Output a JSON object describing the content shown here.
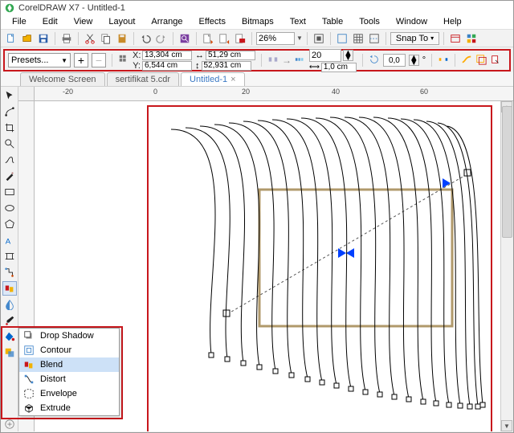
{
  "app": {
    "title": "CorelDRAW X7 - Untitled-1"
  },
  "menus": [
    "File",
    "Edit",
    "View",
    "Layout",
    "Arrange",
    "Effects",
    "Bitmaps",
    "Text",
    "Table",
    "Tools",
    "Window",
    "Help"
  ],
  "toolbar": {
    "zoom": "26%",
    "snap_label": "Snap To"
  },
  "prop": {
    "presets_label": "Presets...",
    "x_label": "X:",
    "y_label": "Y:",
    "x_val": "13,304 cm",
    "y_val": "6,544 cm",
    "w_val": "51,29 cm",
    "h_val": "52,931 cm",
    "steps": "20",
    "step_dist": "1,0 cm",
    "angle": "0,0",
    "deg": "°"
  },
  "tabs": [
    {
      "label": "Welcome Screen",
      "active": false
    },
    {
      "label": "sertifikat 5.cdr",
      "active": false
    },
    {
      "label": "Untitled-1",
      "active": true
    }
  ],
  "ruler": {
    "marks": [
      "-20",
      "0",
      "20",
      "40",
      "60"
    ]
  },
  "flyout": {
    "items": [
      {
        "label": "Drop Shadow",
        "sel": false,
        "icon": "shadow"
      },
      {
        "label": "Contour",
        "sel": false,
        "icon": "contour"
      },
      {
        "label": "Blend",
        "sel": true,
        "icon": "blend"
      },
      {
        "label": "Distort",
        "sel": false,
        "icon": "distort"
      },
      {
        "label": "Envelope",
        "sel": false,
        "icon": "envelope"
      },
      {
        "label": "Extrude",
        "sel": false,
        "icon": "extrude"
      }
    ]
  }
}
